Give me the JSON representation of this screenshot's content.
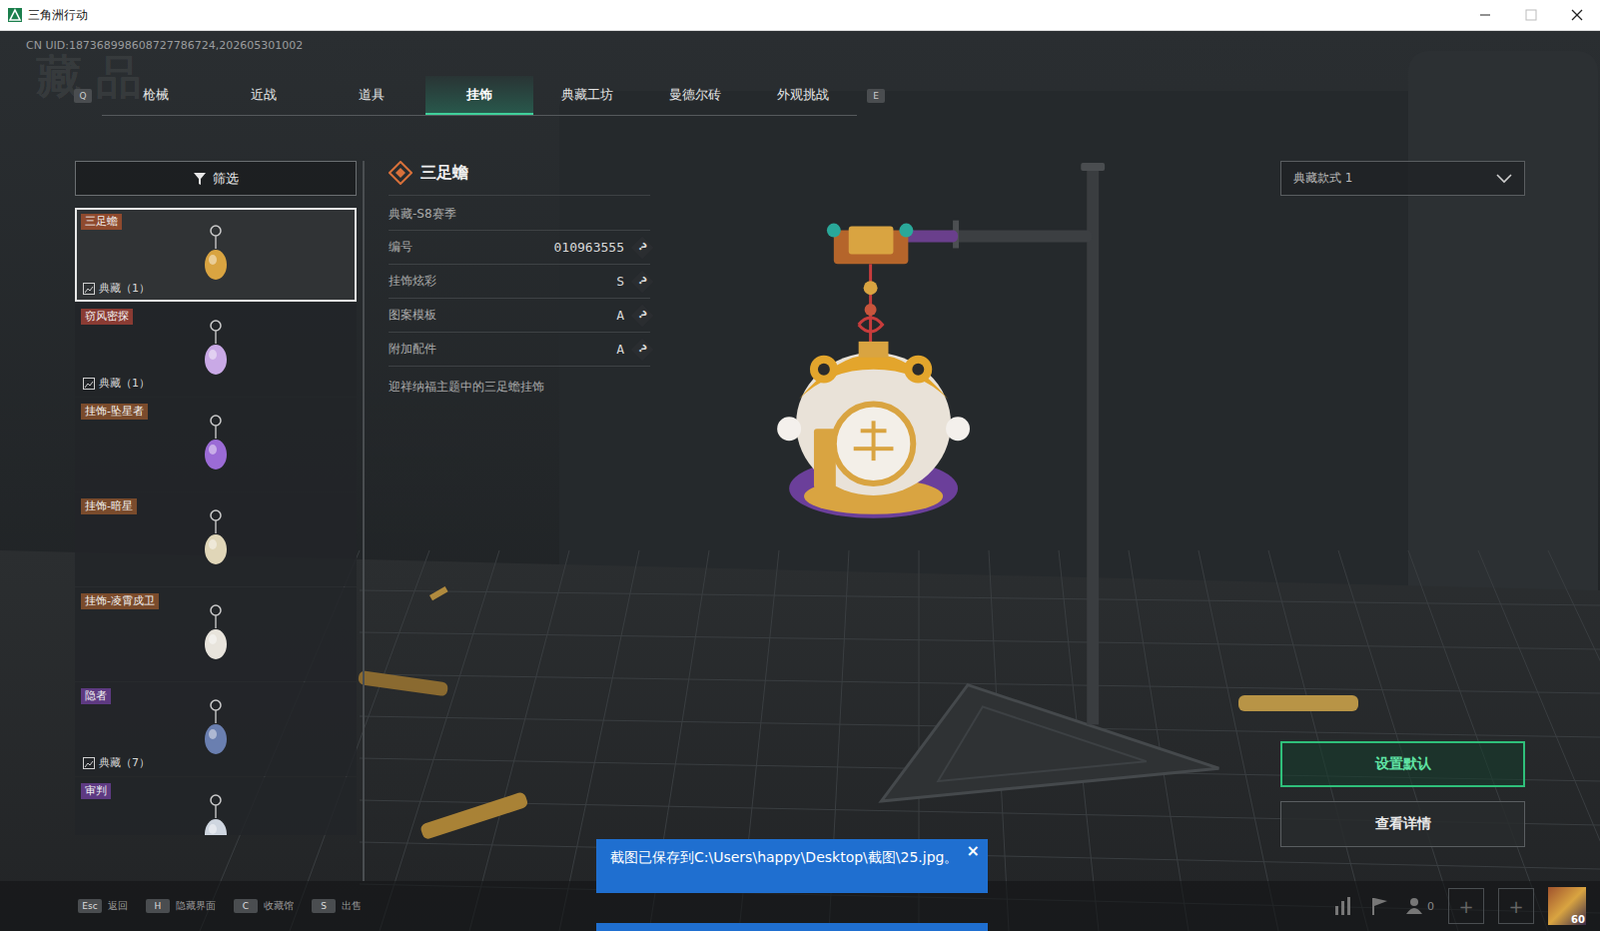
{
  "window": {
    "title": "三角洲行动",
    "uid": "CN UID:187368998608727786724,202605301002",
    "watermark": "藏品"
  },
  "tab_keys": {
    "prev": "Q",
    "next": "E"
  },
  "tabs": [
    {
      "label": "枪械",
      "selected": false
    },
    {
      "label": "近战",
      "selected": false
    },
    {
      "label": "道具",
      "selected": false
    },
    {
      "label": "挂饰",
      "selected": true
    },
    {
      "label": "典藏工坊",
      "selected": false
    },
    {
      "label": "曼德尔砖",
      "selected": false
    },
    {
      "label": "外观挑战",
      "selected": false
    }
  ],
  "filter": {
    "label": "筛选"
  },
  "items": [
    {
      "name": "三足蟾",
      "selected": true,
      "color": "#8f4a2e",
      "collection": "典藏（1）"
    },
    {
      "name": "窃风密探",
      "selected": false,
      "color": "#8a3b33",
      "collection": "典藏（1）"
    },
    {
      "name": "挂饰-坠星者",
      "selected": false,
      "color": "#7a4b2c",
      "collection": null
    },
    {
      "name": "挂饰-暗星",
      "selected": false,
      "color": "#7a4b2c",
      "collection": null
    },
    {
      "name": "挂饰-凌霄戍卫",
      "selected": false,
      "color": "#7a4b2c",
      "collection": null
    },
    {
      "name": "隐者",
      "selected": false,
      "color": "#5e3a82",
      "collection": "典藏（7）"
    },
    {
      "name": "审判",
      "selected": false,
      "color": "#5e3a82",
      "collection": null
    }
  ],
  "detail": {
    "title": "三足蟾",
    "season": "典藏-S8赛季",
    "rows": [
      {
        "label": "编号",
        "value": "010963555",
        "help": "?"
      },
      {
        "label": "挂饰炫彩",
        "value": "S",
        "help": "?"
      },
      {
        "label": "图案模板",
        "value": "A",
        "help": "?"
      },
      {
        "label": "附加配件",
        "value": "A",
        "help": "?"
      }
    ],
    "description": "迎祥纳福主题中的三足蟾挂饰"
  },
  "style_select": {
    "value": "典藏款式 1"
  },
  "buttons": [
    {
      "label": "设置默认",
      "kind": "primary"
    },
    {
      "label": "查看详情",
      "kind": "secondary"
    }
  ],
  "hints": [
    {
      "key": "Esc",
      "label": "返回"
    },
    {
      "key": "H",
      "label": "隐藏界面"
    },
    {
      "key": "C",
      "label": "收藏馆"
    },
    {
      "key": "S",
      "label": "出售"
    }
  ],
  "status": {
    "friends": "0",
    "slots": [
      "+",
      "+"
    ],
    "level": "60"
  },
  "toast": {
    "message": "截图已保存到C:\\Users\\happy\\Desktop\\截图\\25.jpg。",
    "close": "×"
  }
}
